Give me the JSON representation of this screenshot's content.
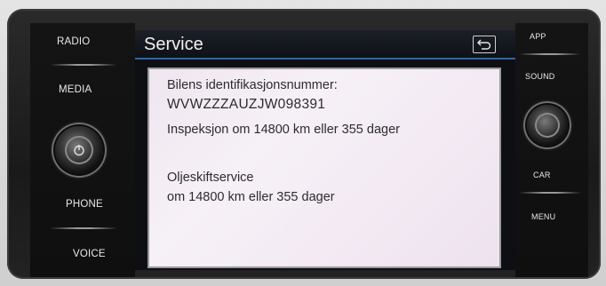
{
  "left_buttons": {
    "radio": "RADIO",
    "media": "MEDIA",
    "phone": "PHONE",
    "voice": "VOICE"
  },
  "right_buttons": {
    "app": "APP",
    "sound": "SOUND",
    "car": "CAR",
    "menu": "MENU"
  },
  "screen": {
    "title": "Service",
    "vin_label": "Bilens identifikasjonsnummer:",
    "vin_value": "WVWZZZAUZJW098391",
    "inspection": "Inspeksjon om 14800 km eller 355 dager",
    "oil_title": "Oljeskiftservice",
    "oil_due": "om 14800 km eller 355 dager"
  },
  "icons": {
    "left_knob": "power-icon",
    "back": "back-arrow-icon"
  },
  "colors": {
    "title_underline": "#2f66a8",
    "content_background": "#f3eaf4"
  }
}
